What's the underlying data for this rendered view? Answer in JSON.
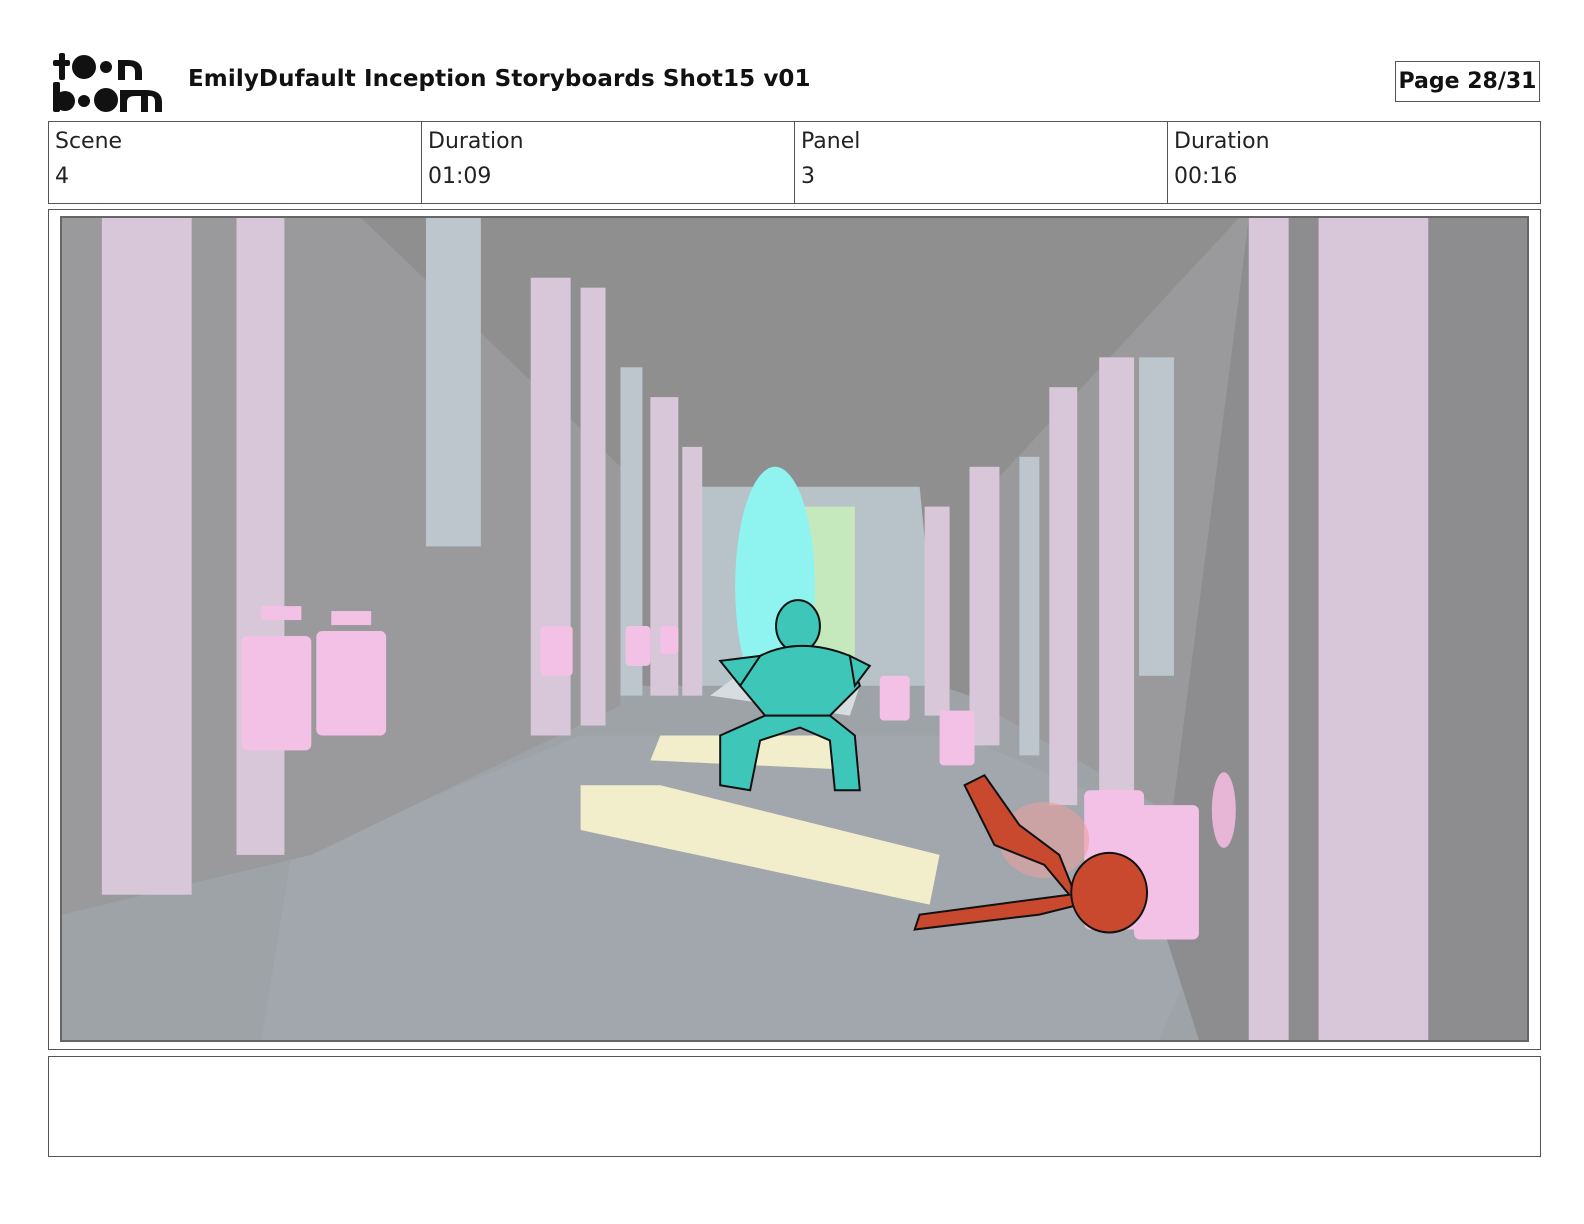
{
  "header": {
    "logo_text": "toon boom",
    "title": "EmilyDufault Inception Storyboards Shot15 v01",
    "page": "Page 28/31"
  },
  "info": [
    {
      "label": "Scene",
      "value": "4"
    },
    {
      "label": "Duration",
      "value": "01:09"
    },
    {
      "label": "Panel",
      "value": "3"
    },
    {
      "label": "Duration",
      "value": "00:16"
    }
  ],
  "notes": "",
  "colors": {
    "border": "#555555",
    "wall_pink": "#d8c7d8",
    "pillar_pink": "#f4c1e6",
    "floor_grey": "#9aa0a6",
    "teal_figure": "#3ec6b8",
    "red_figure": "#c9492f",
    "cyan_glow": "#8ff4f0",
    "yellow_block": "#f2eecb"
  }
}
